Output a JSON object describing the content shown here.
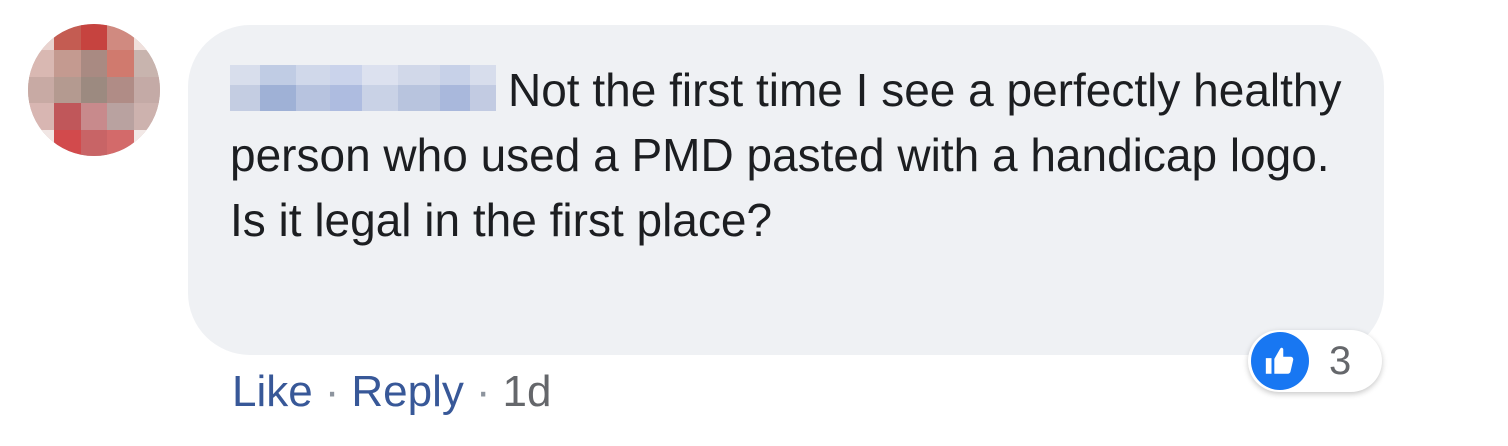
{
  "comment": {
    "author_name": "",
    "text": "Not the first time I see a perfectly healthy person who used a PMD pasted with a handicap logo. Is it legal in the first place?",
    "reaction_icon": "thumbs-up-icon",
    "reaction_count": "3"
  },
  "actions": {
    "like_label": "Like",
    "reply_label": "Reply",
    "separator": "·",
    "timestamp": "1d"
  },
  "colors": {
    "bubble_background": "#eff1f4",
    "link": "#385898",
    "reaction_blue": "#1877f2",
    "text": "#1c1e21",
    "muted": "#65676b"
  }
}
